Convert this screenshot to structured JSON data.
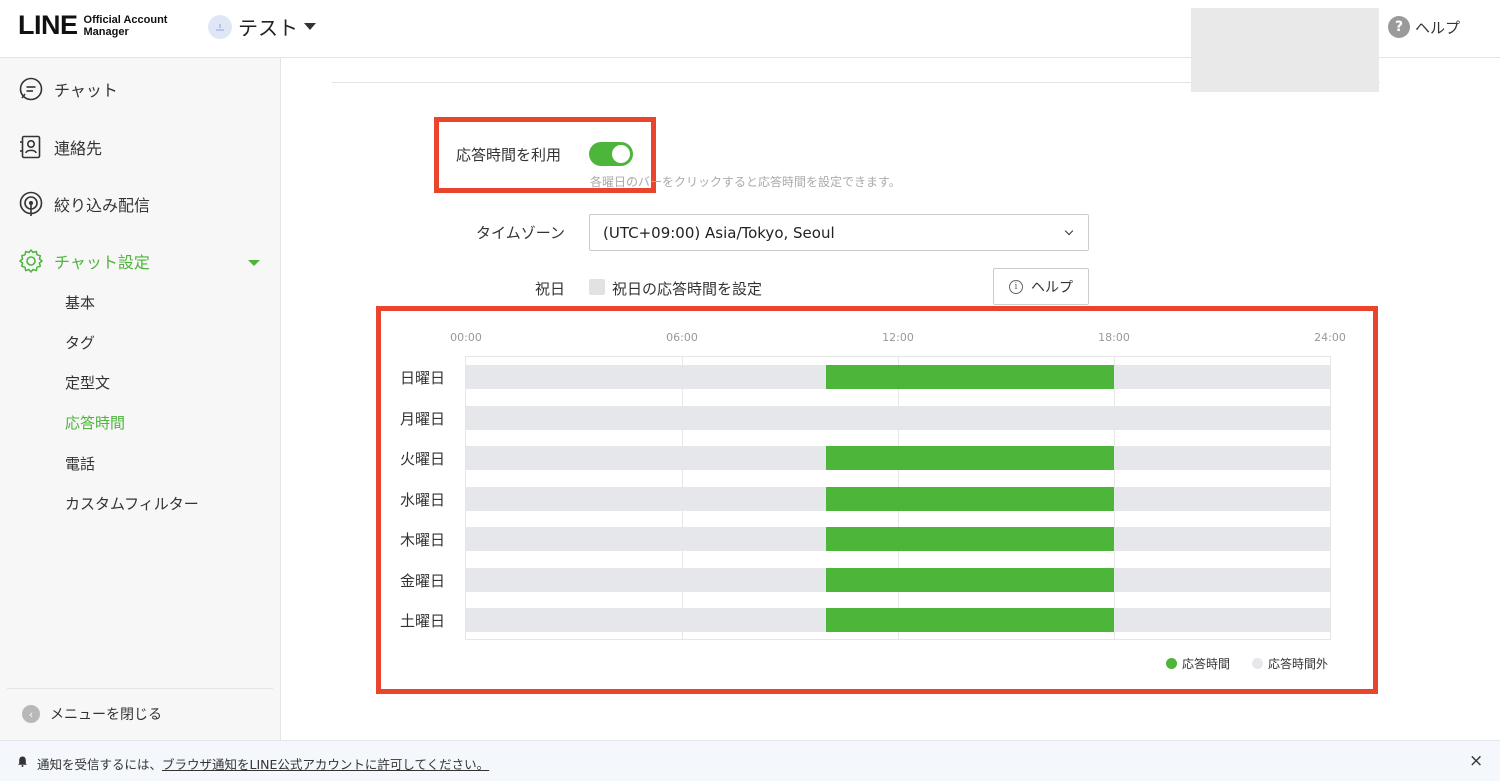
{
  "header": {
    "logo_main": "LINE",
    "logo_sub_line1": "Official Account",
    "logo_sub_line2": "Manager",
    "account_name": "テスト",
    "help_label": "ヘルプ",
    "help_icon": "?"
  },
  "sidebar": {
    "items": [
      {
        "label": "チャット",
        "icon": "chat-bubble-icon"
      },
      {
        "label": "連絡先",
        "icon": "contacts-icon"
      },
      {
        "label": "絞り込み配信",
        "icon": "broadcast-icon"
      },
      {
        "label": "チャット設定",
        "icon": "gear-icon"
      }
    ],
    "subitems": [
      "基本",
      "タグ",
      "定型文",
      "応答時間",
      "電話",
      "カスタムフィルター"
    ],
    "active_subitem": "応答時間",
    "close_label": "メニューを閉じる"
  },
  "settings": {
    "use_response_time_label": "応答時間を利用",
    "toggle_on": true,
    "hint": "各曜日のバーをクリックすると応答時間を設定できます。",
    "timezone_label": "タイムゾーン",
    "timezone_value": "(UTC+09:00) Asia/Tokyo, Seoul",
    "holiday_label": "祝日",
    "holiday_checkbox_label": "祝日の応答時間を設定",
    "help_button_label": "ヘルプ",
    "info_icon": "i"
  },
  "chart_data": {
    "type": "bar",
    "x_ticks": [
      "00:00",
      "06:00",
      "12:00",
      "18:00",
      "24:00"
    ],
    "xlim": [
      0,
      24
    ],
    "categories": [
      "日曜日",
      "月曜日",
      "火曜日",
      "水曜日",
      "木曜日",
      "金曜日",
      "土曜日"
    ],
    "series": [
      {
        "name": "応答時間",
        "ranges": [
          [
            10,
            18
          ],
          null,
          [
            10,
            18
          ],
          [
            10,
            18
          ],
          [
            10,
            18
          ],
          [
            10,
            18
          ],
          [
            10,
            18
          ]
        ]
      }
    ],
    "legend": [
      "応答時間",
      "応答時間外"
    ],
    "legend_position": "bottom-right",
    "colors": {
      "on": "#4cb53a",
      "off": "#e6e7ea"
    }
  },
  "notification": {
    "text_before": "通知を受信するには、",
    "link_text": "ブラウザ通知をLINE公式アカウントに許可してください。",
    "close_icon": "×"
  }
}
